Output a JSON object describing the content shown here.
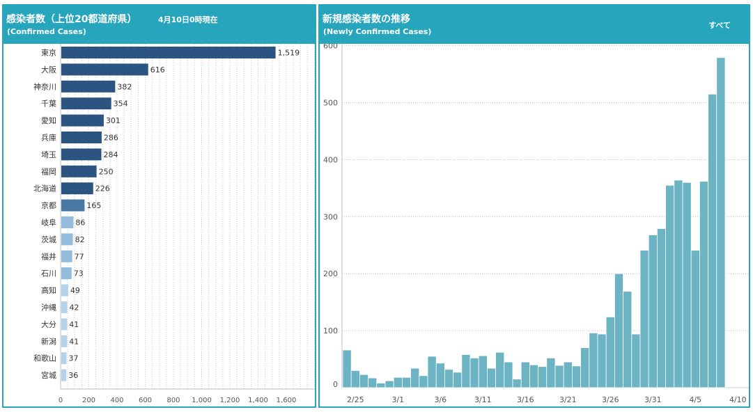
{
  "left_panel": {
    "title": "感染者数（上位20都道府県）",
    "subtitle": "(Confirmed Cases)",
    "as_of": "4月10日0時現在"
  },
  "right_panel": {
    "title": "新規感染者数の推移",
    "subtitle": "(Newly Confirmed Cases)",
    "filter_label": "すべて"
  },
  "chart_data": [
    {
      "type": "bar",
      "orientation": "horizontal",
      "categories": [
        "東京",
        "大阪",
        "神奈川",
        "千葉",
        "愛知",
        "兵庫",
        "埼玉",
        "福岡",
        "北海道",
        "京都",
        "岐阜",
        "茨城",
        "福井",
        "石川",
        "高知",
        "沖縄",
        "大分",
        "新潟",
        "和歌山",
        "宮城"
      ],
      "values": [
        1519,
        616,
        382,
        354,
        301,
        286,
        284,
        250,
        226,
        165,
        86,
        82,
        77,
        73,
        49,
        42,
        41,
        41,
        37,
        36
      ],
      "value_labels": [
        "1,519",
        "616",
        "382",
        "354",
        "301",
        "286",
        "284",
        "250",
        "226",
        "165",
        "86",
        "82",
        "77",
        "73",
        "49",
        "42",
        "41",
        "41",
        "37",
        "36"
      ],
      "xlim": [
        0,
        1800
      ],
      "xticks": [
        0,
        200,
        400,
        600,
        800,
        1000,
        1200,
        1400,
        1600
      ],
      "xtick_labels": [
        "0",
        "200",
        "400",
        "600",
        "800",
        "1,000",
        "1,200",
        "1,400",
        "1,600"
      ],
      "grid": "vertical-dotted",
      "colors": {
        "high": "#2b5580",
        "mid": "#4a78a4",
        "low": "#93bcdc",
        "lowest": "#b4d3ea"
      }
    },
    {
      "type": "bar",
      "orientation": "vertical",
      "x": [
        "2/24",
        "2/25",
        "2/26",
        "2/27",
        "2/28",
        "2/29",
        "3/1",
        "3/2",
        "3/3",
        "3/4",
        "3/5",
        "3/6",
        "3/7",
        "3/8",
        "3/9",
        "3/10",
        "3/11",
        "3/12",
        "3/13",
        "3/14",
        "3/15",
        "3/16",
        "3/17",
        "3/18",
        "3/19",
        "3/20",
        "3/21",
        "3/22",
        "3/23",
        "3/24",
        "3/25",
        "3/26",
        "3/27",
        "3/28",
        "3/29",
        "3/30",
        "3/31",
        "4/1",
        "4/2",
        "4/3",
        "4/4",
        "4/5",
        "4/6",
        "4/7",
        "4/8",
        "4/9"
      ],
      "values": [
        66,
        30,
        23,
        17,
        8,
        12,
        18,
        18,
        34,
        21,
        55,
        43,
        32,
        27,
        58,
        52,
        56,
        34,
        62,
        45,
        15,
        45,
        40,
        37,
        52,
        39,
        45,
        38,
        70,
        96,
        94,
        124,
        200,
        169,
        94,
        241,
        268,
        279,
        355,
        364,
        360,
        241,
        362,
        515,
        579
      ],
      "xtick_labels": [
        "2/25",
        "3/1",
        "3/6",
        "3/11",
        "3/16",
        "3/21",
        "3/26",
        "3/31",
        "4/5",
        "4/10"
      ],
      "ylim": [
        0,
        600
      ],
      "yticks": [
        0,
        100,
        200,
        300,
        400,
        500,
        600
      ],
      "grid": "horizontal-dotted",
      "color": "#6cb3c4"
    }
  ]
}
